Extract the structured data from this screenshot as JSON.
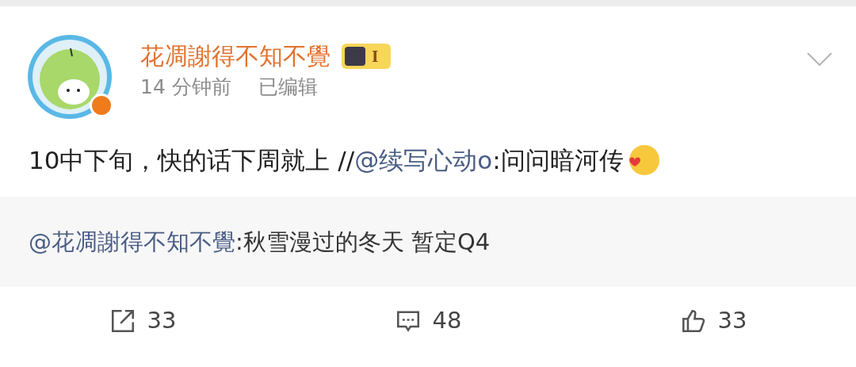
{
  "post": {
    "author": "花凋謝得不知不覺",
    "level_badge": "I",
    "time": "14 分钟前",
    "edited": "已编辑",
    "text_before": "10中下旬，快的话下周就上 //",
    "mention": "@续写心动o",
    "text_after": ":问问暗河传"
  },
  "quoted": {
    "mention": "@花凋謝得不知不覺",
    "text": ":秋雪漫过的冬天 暂定Q4"
  },
  "actions": [
    {
      "kind": "repost",
      "count": "33"
    },
    {
      "kind": "comment",
      "count": "48"
    },
    {
      "kind": "like",
      "count": "33"
    }
  ]
}
